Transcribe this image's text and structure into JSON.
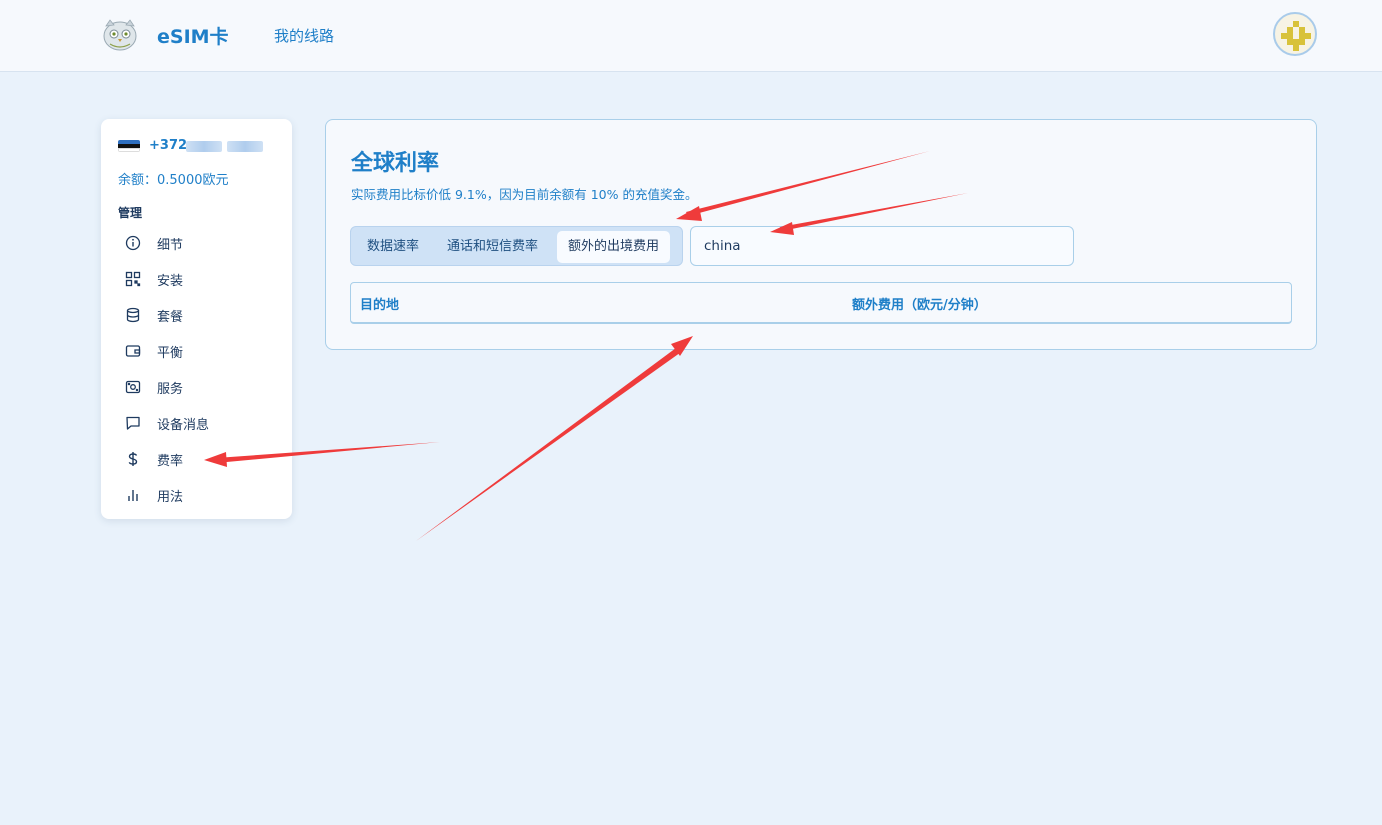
{
  "header": {
    "brand": "eSIM卡",
    "nav_link": "我的线路"
  },
  "sidebar": {
    "phone_prefix": "+372",
    "balance": "余额：0.5000欧元",
    "section_label": "管理",
    "items": [
      {
        "label": "细节",
        "icon": "info-icon"
      },
      {
        "label": "安装",
        "icon": "qr-code-icon"
      },
      {
        "label": "套餐",
        "icon": "database-icon"
      },
      {
        "label": "平衡",
        "icon": "wallet-icon"
      },
      {
        "label": "服务",
        "icon": "router-icon"
      },
      {
        "label": "设备消息",
        "icon": "message-icon"
      },
      {
        "label": "费率",
        "icon": "dollar-icon"
      },
      {
        "label": "用法",
        "icon": "bar-chart-icon"
      }
    ]
  },
  "main": {
    "title": "全球利率",
    "subtitle": "实际费用比标价低 9.1%，因为目前余额有 10% 的充值奖金。",
    "tabs": [
      {
        "label": "数据速率",
        "active": false
      },
      {
        "label": "通话和短信费率",
        "active": false
      },
      {
        "label": "额外的出境费用",
        "active": true
      }
    ],
    "search_value": "china",
    "table": {
      "headers": [
        "目的地",
        "额外费用（欧元/分钟）"
      ]
    }
  },
  "colors": {
    "accent": "#1f7fc8",
    "page_bg": "#e9f2fb",
    "annotation_arrow": "#ef3b3b"
  }
}
